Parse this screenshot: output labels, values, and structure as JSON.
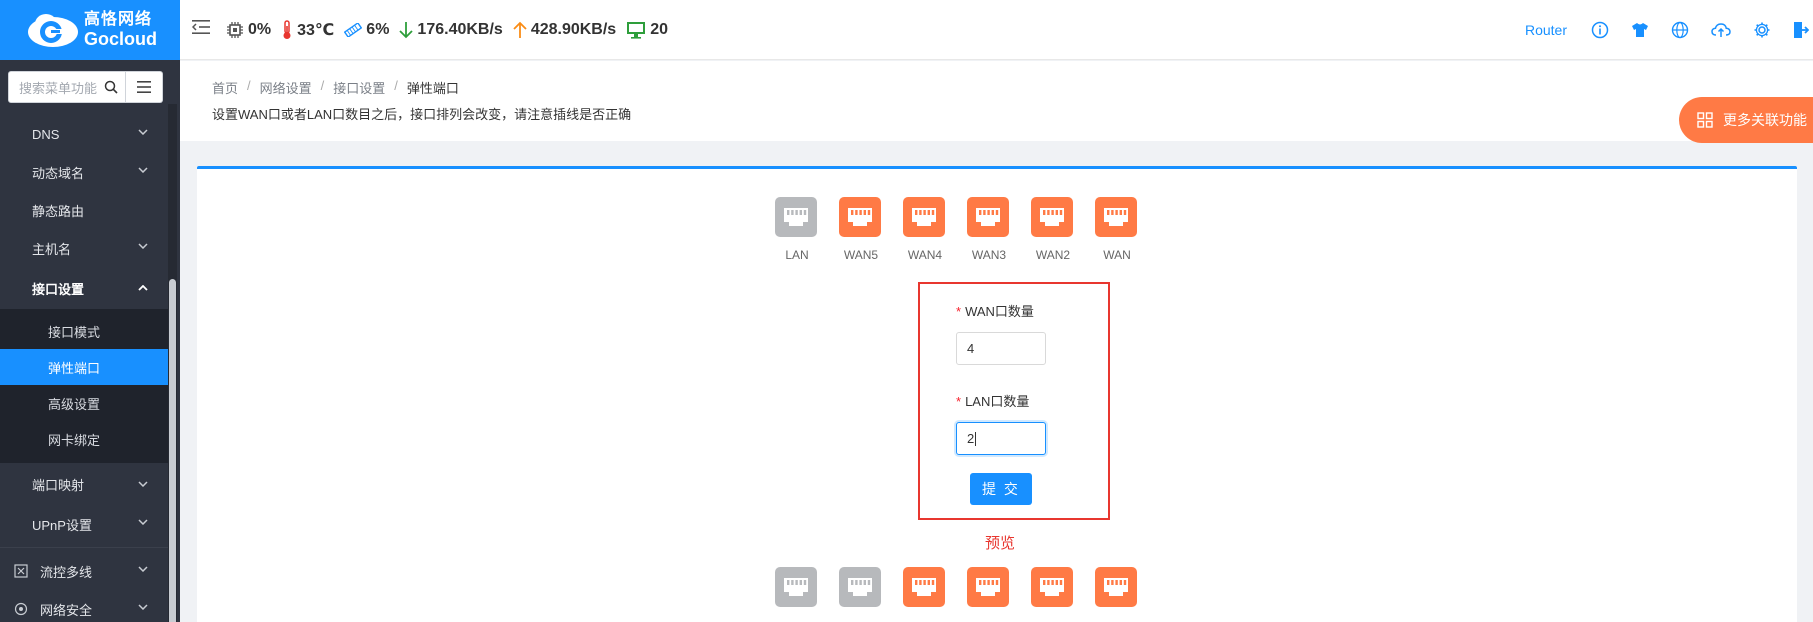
{
  "brand": {
    "name_cn": "高恪网络",
    "name_en": "Gocloud",
    "color": "#1890ff"
  },
  "sidebar": {
    "search_placeholder": "搜索菜单功能",
    "items": [
      {
        "label": "DNS",
        "expandable": true
      },
      {
        "label": "动态域名",
        "expandable": true
      },
      {
        "label": "静态路由",
        "expandable": false
      },
      {
        "label": "主机名",
        "expandable": true
      },
      {
        "label": "接口设置",
        "expandable": true,
        "expanded": true
      },
      {
        "label": "端口映射",
        "expandable": true
      },
      {
        "label": "UPnP设置",
        "expandable": true
      }
    ],
    "subitems": [
      {
        "label": "接口模式",
        "active": false
      },
      {
        "label": "弹性端口",
        "active": true
      },
      {
        "label": "高级设置",
        "active": false
      },
      {
        "label": "网卡绑定",
        "active": false
      }
    ],
    "groups": [
      {
        "label": "流控多线",
        "icon": "flow-icon"
      },
      {
        "label": "网络安全",
        "icon": "security-icon"
      }
    ]
  },
  "status": {
    "cpu": "0%",
    "temp": "33℃",
    "mem": "6%",
    "down": "176.40KB/s",
    "up": "428.90KB/s",
    "clients": "20"
  },
  "topright": {
    "router_label": "Router",
    "icons": [
      "info-icon",
      "shirt-icon",
      "globe-icon",
      "cloud-upload-icon",
      "settings-icon",
      "logout-icon"
    ]
  },
  "breadcrumb": [
    "首页",
    "网络设置",
    "接口设置",
    "弹性端口"
  ],
  "hint": "设置WAN口或者LAN口数目之后，接口排列会改变，请注意插线是否正确",
  "more_button": "更多关联功能",
  "current_ports": [
    {
      "label": "LAN",
      "type": "lan"
    },
    {
      "label": "WAN5",
      "type": "wan"
    },
    {
      "label": "WAN4",
      "type": "wan"
    },
    {
      "label": "WAN3",
      "type": "wan"
    },
    {
      "label": "WAN2",
      "type": "wan"
    },
    {
      "label": "WAN",
      "type": "wan"
    }
  ],
  "form": {
    "wan_label": "WAN口数量",
    "wan_value": "4",
    "lan_label": "LAN口数量",
    "lan_value": "2",
    "submit": "提 交"
  },
  "preview": {
    "label": "预览",
    "ports": [
      {
        "type": "lan"
      },
      {
        "type": "lan"
      },
      {
        "type": "wan"
      },
      {
        "type": "wan"
      },
      {
        "type": "wan"
      },
      {
        "type": "wan"
      }
    ]
  },
  "colors": {
    "lan": "#b7b9bc",
    "wan": "#ff7a45",
    "accent": "#1890ff",
    "alert": "#e8362f"
  }
}
